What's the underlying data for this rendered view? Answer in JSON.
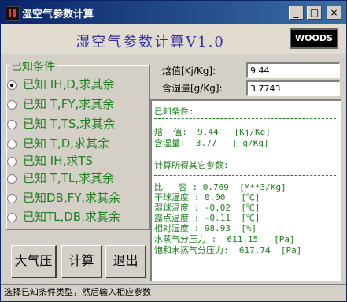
{
  "window": {
    "title": "湿空气参数计算",
    "controls": [
      "_",
      "□",
      "×"
    ]
  },
  "header": {
    "app_title": "湿空气参数计算V1.0",
    "logo_text": "WOODS"
  },
  "known": {
    "group_label": "已知条件",
    "options": [
      {
        "label": "已知 IH,D,求其余",
        "selected": true
      },
      {
        "label": "已知 T,FY,求其余",
        "selected": false
      },
      {
        "label": "已知 T,TS,求其余",
        "selected": false
      },
      {
        "label": "已知 T,D,求其余",
        "selected": false
      },
      {
        "label": "已知 IH,求TS",
        "selected": false
      },
      {
        "label": "已知 T,TL,求其余",
        "selected": false
      },
      {
        "label": "已知DB,FY,求其余",
        "selected": false
      },
      {
        "label": "已知TL,DB,求其余",
        "selected": false
      }
    ]
  },
  "inputs": {
    "enthalpy_label": "焓值[Kj/Kg]:",
    "enthalpy_value": "9.44",
    "moisture_label": "含湿量[g/Kg]:",
    "moisture_value": "3.7743"
  },
  "results": {
    "known_heading": "已知条件:",
    "known_lines": [
      "焓  值:  9.44   [Kj/Kg]",
      "含湿量:  3.77   [ g/Kg]"
    ],
    "calc_heading": "计算所得其它参数:",
    "calc_lines": [
      "比   容 : 0.769  [M**3/Kg]",
      "干球温度 : 0.00   [℃]",
      "湿球温度 : -0.02  [℃]",
      "露点温度 : -0.11  [℃]",
      "相对湿度 : 98.93  [%]",
      "水蒸气分压力 :  611.15   [Pa]",
      "饱和水蒸气分压力:  617.74  [Pa]"
    ]
  },
  "buttons": {
    "pressure": "大气压",
    "calculate": "计算",
    "exit": "退出"
  },
  "status": {
    "text": "选择已知条件类型，然后输入相应参数"
  }
}
